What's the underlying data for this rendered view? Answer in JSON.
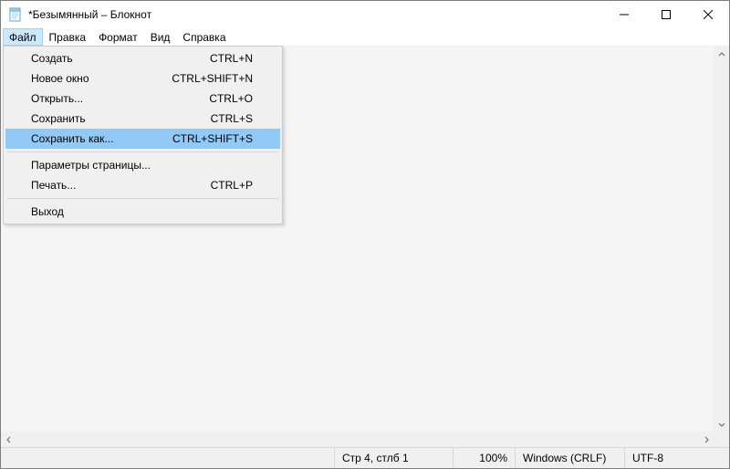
{
  "window": {
    "title": "*Безымянный – Блокнот"
  },
  "menubar": {
    "items": [
      {
        "label": "Файл"
      },
      {
        "label": "Правка"
      },
      {
        "label": "Формат"
      },
      {
        "label": "Вид"
      },
      {
        "label": "Справка"
      }
    ]
  },
  "file_menu": {
    "items": [
      {
        "label": "Создать",
        "shortcut": "CTRL+N"
      },
      {
        "label": "Новое окно",
        "shortcut": "CTRL+SHIFT+N"
      },
      {
        "label": "Открыть...",
        "shortcut": "CTRL+O"
      },
      {
        "label": "Сохранить",
        "shortcut": "CTRL+S"
      },
      {
        "label": "Сохранить как...",
        "shortcut": "CTRL+SHIFT+S",
        "highlighted": true
      }
    ],
    "items2": [
      {
        "label": "Параметры страницы...",
        "shortcut": ""
      },
      {
        "label": "Печать...",
        "shortcut": "CTRL+P"
      }
    ],
    "items3": [
      {
        "label": "Выход",
        "shortcut": ""
      }
    ]
  },
  "statusbar": {
    "position": "Стр 4, стлб 1",
    "zoom": "100%",
    "line_ending": "Windows (CRLF)",
    "encoding": "UTF-8"
  }
}
